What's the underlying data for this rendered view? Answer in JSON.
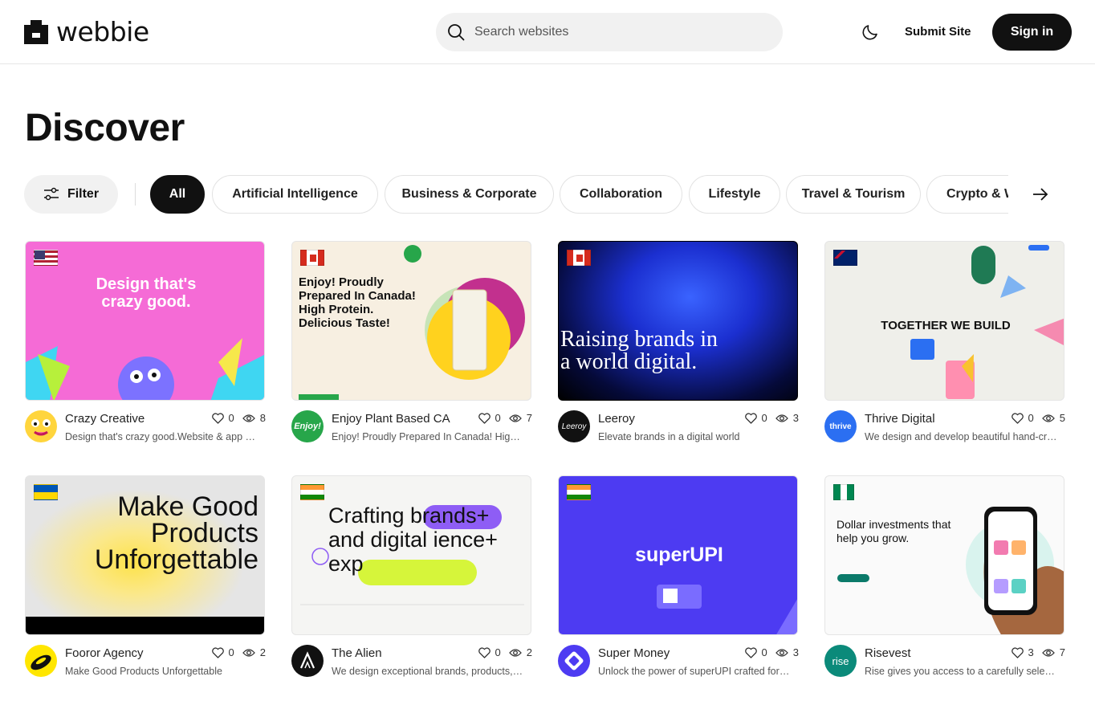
{
  "header": {
    "logo_text": "webbie",
    "search_placeholder": "Search websites",
    "submit_label": "Submit Site",
    "signin_label": "Sign in"
  },
  "page": {
    "title": "Discover"
  },
  "filters": {
    "filter_label": "Filter",
    "chips": [
      "All",
      "Artificial Intelligence",
      "Business & Corporate",
      "Collaboration",
      "Lifestyle",
      "Travel & Tourism",
      "Crypto & W"
    ]
  },
  "cards": [
    {
      "title": "Crazy Creative",
      "desc": "Design that's crazy good.Website & app design",
      "likes": "0",
      "views": "8",
      "flag": "US",
      "thumb_headline": "Design that's crazy good."
    },
    {
      "title": "Enjoy Plant Based CA",
      "desc": "Enjoy! Proudly Prepared In Canada! High Protein",
      "likes": "0",
      "views": "7",
      "flag": "CA",
      "thumb_headline": "Enjoy! Proudly Prepared In Canada! High Protein. Delicious Taste!",
      "avatar_text": "Enjoy!"
    },
    {
      "title": "Leeroy",
      "desc": "Elevate brands in a digital world",
      "likes": "0",
      "views": "3",
      "flag": "CA",
      "thumb_headline": "Raising brands in a world digital.",
      "avatar_text": "Leeroy"
    },
    {
      "title": "Thrive Digital",
      "desc": "We design and develop beautiful hand-crafted sites",
      "likes": "0",
      "views": "5",
      "flag": "AU",
      "thumb_headline": "TOGETHER WE BUILD",
      "avatar_text": "thrive"
    },
    {
      "title": "Fooror Agency",
      "desc": "Make Good Products Unforgettable",
      "likes": "0",
      "views": "2",
      "flag": "UA",
      "thumb_headline": "Make Good Products Unforgettable"
    },
    {
      "title": "The Alien",
      "desc": "We design exceptional brands, products, web apps",
      "likes": "0",
      "views": "2",
      "flag": "IN",
      "thumb_headline": "Crafting brands+ and digital ience+ exp"
    },
    {
      "title": "Super Money",
      "desc": "Unlock the power of superUPI crafted for the superSix",
      "likes": "0",
      "views": "3",
      "flag": "IN",
      "thumb_headline": "superUPI"
    },
    {
      "title": "Risevest",
      "desc": "Rise gives you access to a carefully selected portfolio",
      "likes": "3",
      "views": "7",
      "flag": "NG",
      "thumb_headline": "Dollar investments that help you grow.",
      "avatar_text": "rise"
    }
  ],
  "colors": {
    "brand_dark": "#111111",
    "chip_bg": "#f1f1f1"
  }
}
